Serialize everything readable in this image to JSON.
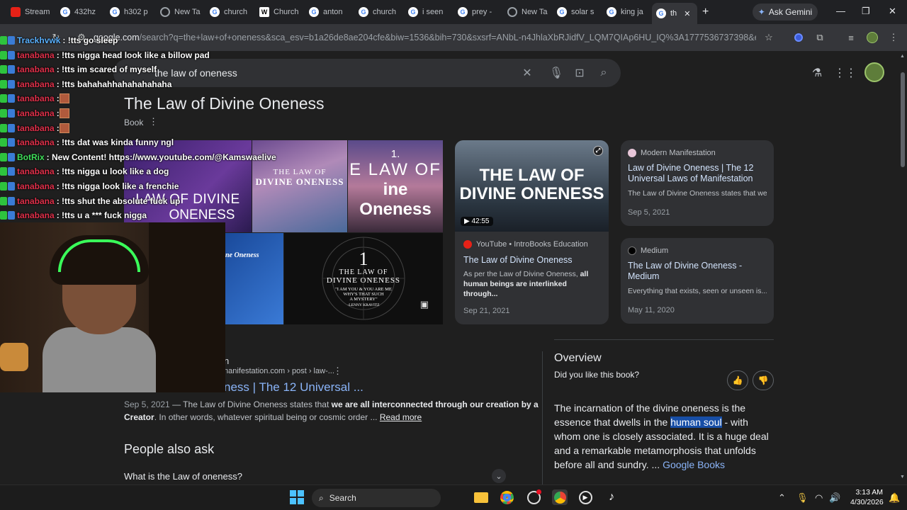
{
  "tabs": [
    {
      "label": "Stream",
      "icon": "youtube-icon"
    },
    {
      "label": "432hz",
      "icon": "google-icon"
    },
    {
      "label": "h302 p",
      "icon": "google-icon"
    },
    {
      "label": "New Ta",
      "icon": "chrome-icon"
    },
    {
      "label": "church",
      "icon": "google-icon"
    },
    {
      "label": "Church",
      "icon": "wikipedia-icon"
    },
    {
      "label": "anton",
      "icon": "google-icon"
    },
    {
      "label": "church",
      "icon": "google-icon"
    },
    {
      "label": "i seen",
      "icon": "google-icon"
    },
    {
      "label": "prey -",
      "icon": "google-icon"
    },
    {
      "label": "New Ta",
      "icon": "chrome-icon"
    },
    {
      "label": "solar s",
      "icon": "google-icon"
    },
    {
      "label": "king ja",
      "icon": "google-icon"
    },
    {
      "label": "th",
      "icon": "google-icon"
    }
  ],
  "browser": {
    "gemini_label": "Ask Gemini",
    "url_host": "google.com",
    "url_path": "/search?q=the+law+of+oneness&sca_esv=b1a26de8ae204cfe&biw=1536&bih=730&sxsrf=ANbL-n4JhlaXbRJidfV_LQM7QIAp6HU_IQ%3A1777536737398&ei=4Q7zabr..."
  },
  "search": {
    "query": "the law of oneness"
  },
  "knowledge_panel": {
    "title": "The Law of Divine Oneness",
    "subtitle": "Book",
    "images": [
      {
        "line1": "LAW OF DIVINE",
        "line2": "ONENESS"
      },
      {
        "line1": "THE LAW OF",
        "line2": "DIVINE ONENESS"
      },
      {
        "line1": "1.",
        "line2": "E LAW OF",
        "line3": "ine Oneness"
      },
      {
        "line1": "ne Oneness"
      },
      {
        "line1": "1",
        "line2": "THE LAW OF",
        "line3": "DIVINE ONENESS",
        "line4": "\"I AM YOU & YOU ARE ME",
        "line5": "WHY'S THAT SUCH",
        "line6": "A MYSTERY\"",
        "line7": "-LENNY KRAVITZ"
      }
    ],
    "video_card": {
      "thumb_text1": "THE LAW OF",
      "thumb_text2": "DIVINE ONENESS",
      "duration": "42:55",
      "source": "YouTube • IntroBooks Education",
      "title": "The Law of Divine Oneness",
      "snippet_plain": "As per the Law of Divine Oneness, ",
      "snippet_bold": "all human beings are interlinked through...",
      "date": "Sep 21, 2021"
    },
    "cards": [
      {
        "source": "Modern Manifestation",
        "title": "Law of Divine Oneness | The 12 Universal Laws of Manifestation",
        "snippet": "The Law of Divine Oneness states that we...",
        "date": "Sep 5, 2021"
      },
      {
        "source": "Medium",
        "title": "The Law of Divine Oneness - Medium",
        "snippet": "Everything that exists, seen or unseen is...",
        "date": "May 11, 2020"
      }
    ]
  },
  "result": {
    "site_name": "n",
    "breadcrumb": "nanifestation.com › post › law-...",
    "title": "ness | The 12 Universal ...",
    "date": "Sep 5, 2021",
    "snippet_plain1": " — The Law of Divine Oneness states that ",
    "snippet_bold": "we are all interconnected through our creation by a",
    "snippet_bold2": "Creator",
    "snippet_plain2": ". In other words, whatever spiritual being or cosmic order ...",
    "read_more": "Read more"
  },
  "people_also_ask": {
    "heading": "People also ask",
    "q1": "What is the Law of oneness?"
  },
  "overview": {
    "heading": "Overview",
    "question": "Did you like this book?",
    "text_before": "The incarnation of the divine oneness is the essence that dwells in the ",
    "highlight": "human soul",
    "text_after": " - with whom one is closely associated. It is a huge deal and a remarkable metamorphosis that unfolds before all and sundry. ... ",
    "link": "Google Books"
  },
  "chat": [
    {
      "user": "Trackhvwk",
      "color": "#5ab1ff",
      "msg": ": !tts go sleep"
    },
    {
      "user": "tanabana",
      "color": "#e0304a",
      "msg": ": !tts nigga head look like a billow pad"
    },
    {
      "user": "tanabana",
      "color": "#e0304a",
      "msg": ": !tts im scared of myself"
    },
    {
      "user": "tanabana",
      "color": "#e0304a",
      "msg": ": !tts bahahahhahahahahaha"
    },
    {
      "user": "tanabana",
      "color": "#e0304a",
      "msg": ": ",
      "emote": true
    },
    {
      "user": "tanabana",
      "color": "#e0304a",
      "msg": ": ",
      "emote": true
    },
    {
      "user": "tanabana",
      "color": "#e0304a",
      "msg": ": ",
      "emote": true
    },
    {
      "user": "tanabana",
      "color": "#e0304a",
      "msg": ": !tts dat was kinda funny ngl"
    },
    {
      "user": "BotRix",
      "color": "#3fe05a",
      "msg": ": New Content! https://www.youtube.com/@Kamswaelive"
    },
    {
      "user": "tanabana",
      "color": "#e0304a",
      "msg": ": !tts nigga u look like a dog"
    },
    {
      "user": "tanabana",
      "color": "#e0304a",
      "msg": ": !tts nigga look like a frenchie"
    },
    {
      "user": "tanabana",
      "color": "#e0304a",
      "msg": ": !tts shut the absolute fuck up"
    },
    {
      "user": "tanabana",
      "color": "#e0304a",
      "msg": ": !tts u a *** fuck nigga"
    }
  ],
  "taskbar": {
    "search_label": "Search",
    "time": "3:13 AM",
    "date": "4/30/2026"
  },
  "colors": {
    "accent_link": "#8ab4f8",
    "highlight_bg": "#174ea6"
  }
}
